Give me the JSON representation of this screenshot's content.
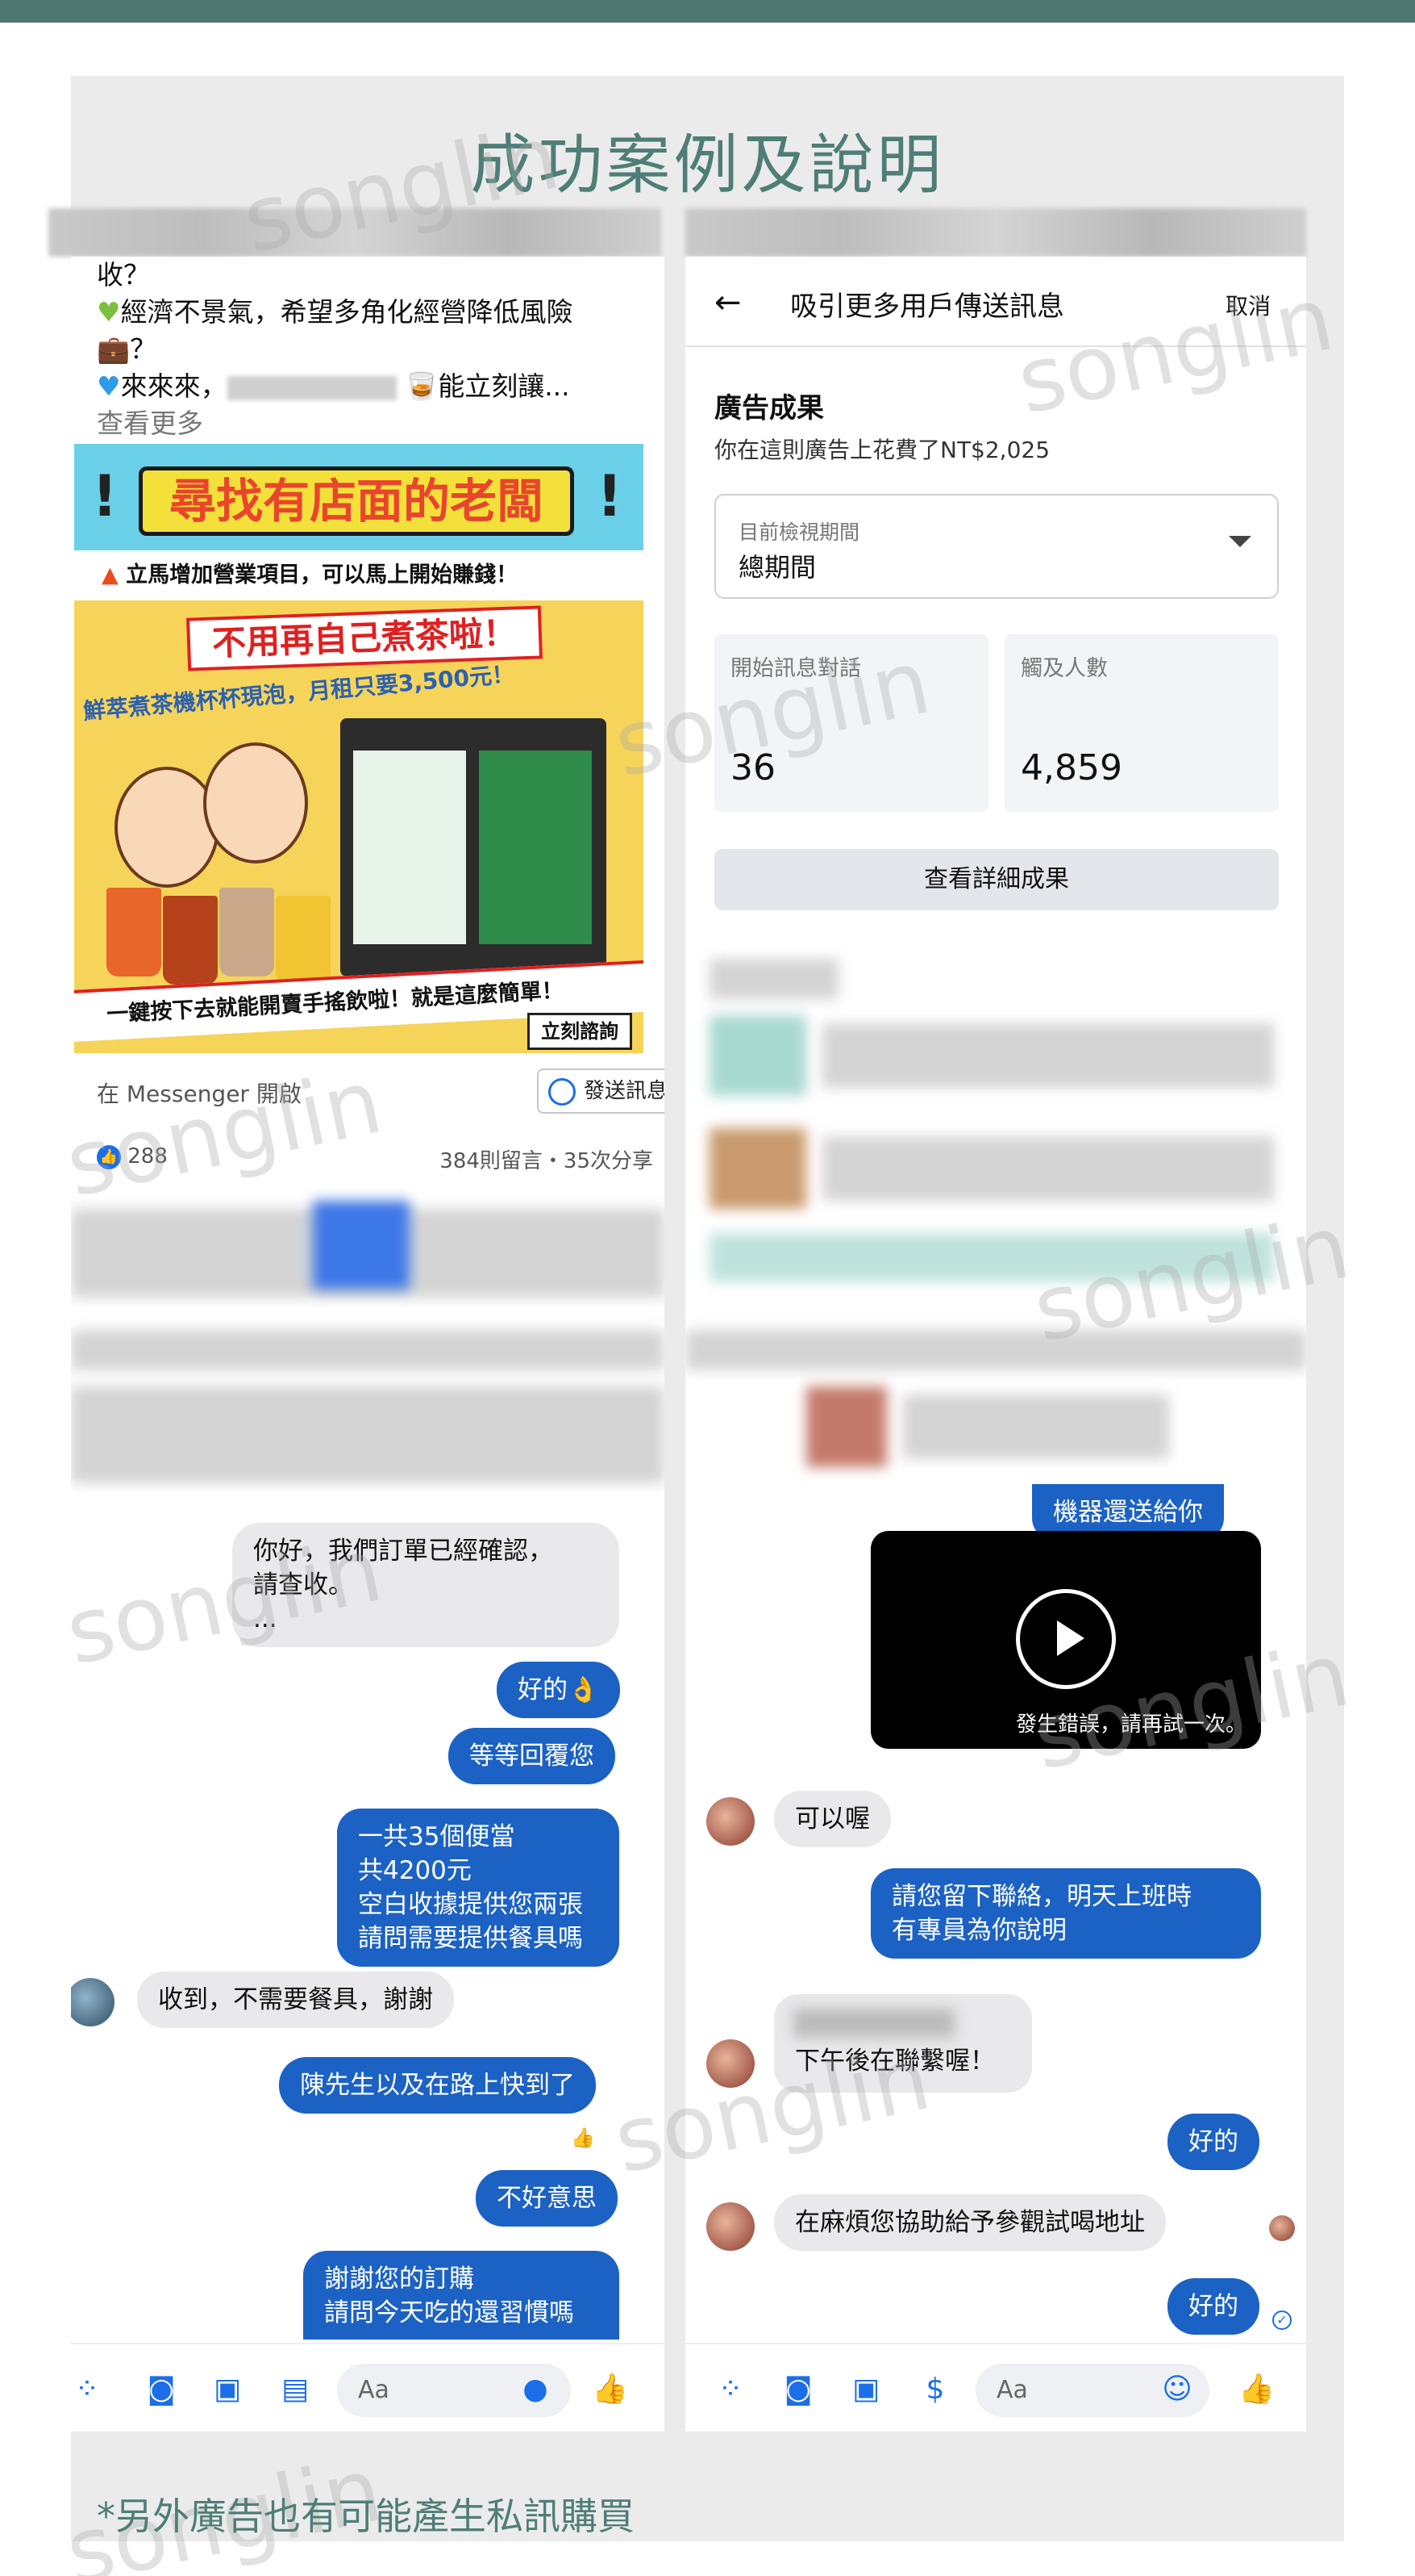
{
  "title": "成功案例及說明",
  "left_post": {
    "lines": [
      "收？",
      "經濟不景氣，希望多角化經營降低風險",
      "？",
      "來來來，",
      "能立刻讓..."
    ],
    "see_more": "查看更多",
    "ad": {
      "headline": "尋找有店面的老闆",
      "strip": "立馬增加營業項目，可以馬上開始賺錢！",
      "red_banner": "不用再自己煮茶啦！",
      "sub": "鮮萃煮茶機杯杯現泡，月租只要3,500元！",
      "bottom": "一鍵按下去就能開賣手搖飲啦！就是這麼簡單！",
      "button": "立刻諮詢"
    },
    "messenger_label": "在 Messenger 開啟",
    "send_button": "發送訊息",
    "likes": "288",
    "comments_shares": "384則留言・35次分享"
  },
  "right_results": {
    "header_title": "吸引更多用戶傳送訊息",
    "cancel": "取消",
    "section_title": "廣告成果",
    "spent": "你在這則廣告上花費了NT$2,025",
    "period_label": "目前檢視期間",
    "period_value": "總期間",
    "stat1_label": "開始訊息對話",
    "stat1_value": "36",
    "stat2_label": "觸及人數",
    "stat2_value": "4,859",
    "details_button": "查看詳細成果"
  },
  "left_chat": {
    "msg1": "你好，我們訂單已經確認，\n請查收。\n...",
    "msg2": "好的👌",
    "msg3": "等等回覆您",
    "msg4": "一共35個便當\n共4200元\n空白收據提供您兩張\n請問需要提供餐具嗎",
    "msg5": "收到，不需要餐具，謝謝",
    "msg6": "陳先生以及在路上快到了",
    "msg7": "不好意思",
    "msg8": "謝謝您的訂購\n請問今天吃的還習慣嗎",
    "input_placeholder": "Aa"
  },
  "right_chat": {
    "top_partial": "機器還送給你",
    "video_error": "發生錯誤，請再試一次。",
    "msg1": "可以喔",
    "msg2": "請您留下聯絡，明天上班時\n有專員為你說明",
    "msg3": "下午後在聯繫喔！",
    "msg4": "好的",
    "msg5": "在麻煩您協助給予參觀試喝地址",
    "msg6": "好的",
    "input_placeholder": "Aa"
  },
  "watermark": "songlin",
  "footer": "*另外廣告也有可能產生私訊購買",
  "colors": {
    "accent": "#4e7e76",
    "messenger_blue": "#1c62c4",
    "fb_blue": "#1c6ee8"
  }
}
